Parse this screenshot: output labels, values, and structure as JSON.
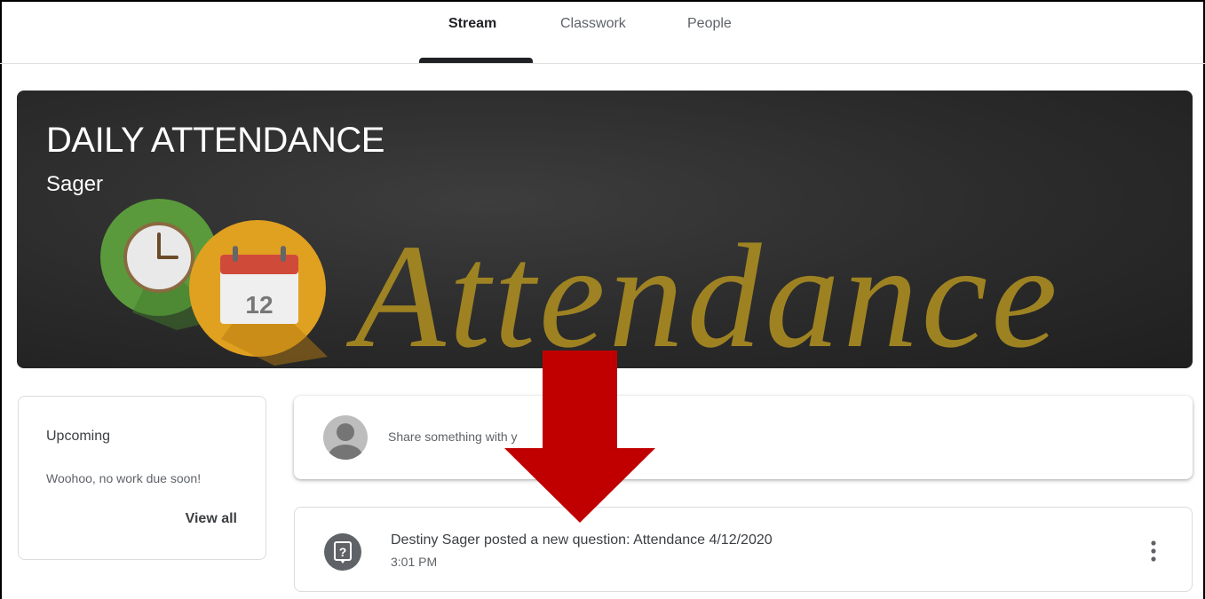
{
  "tabs": [
    {
      "label": "Stream",
      "active": true
    },
    {
      "label": "Classwork",
      "active": false
    },
    {
      "label": "People",
      "active": false
    }
  ],
  "banner": {
    "title": "DAILY ATTENDANCE",
    "subtitle": "Sager",
    "art_text": "Attendance",
    "calendar_day": "12"
  },
  "upcoming": {
    "title": "Upcoming",
    "empty_message": "Woohoo, no work due soon!",
    "view_all_label": "View all"
  },
  "share": {
    "placeholder": "Share something with y"
  },
  "post": {
    "icon": "question-icon",
    "title": "Destiny Sager posted a new question: Attendance 4/12/2020",
    "time": "3:01 PM",
    "menu_icon": "more-vert-icon"
  },
  "colors": {
    "accent": "#202124",
    "banner_bg": "#2b2b2b",
    "art_text": "#a88a22",
    "annotation_arrow": "#c00000",
    "clock_green": "#5a9a3c",
    "calendar_orange": "#e0a020"
  }
}
